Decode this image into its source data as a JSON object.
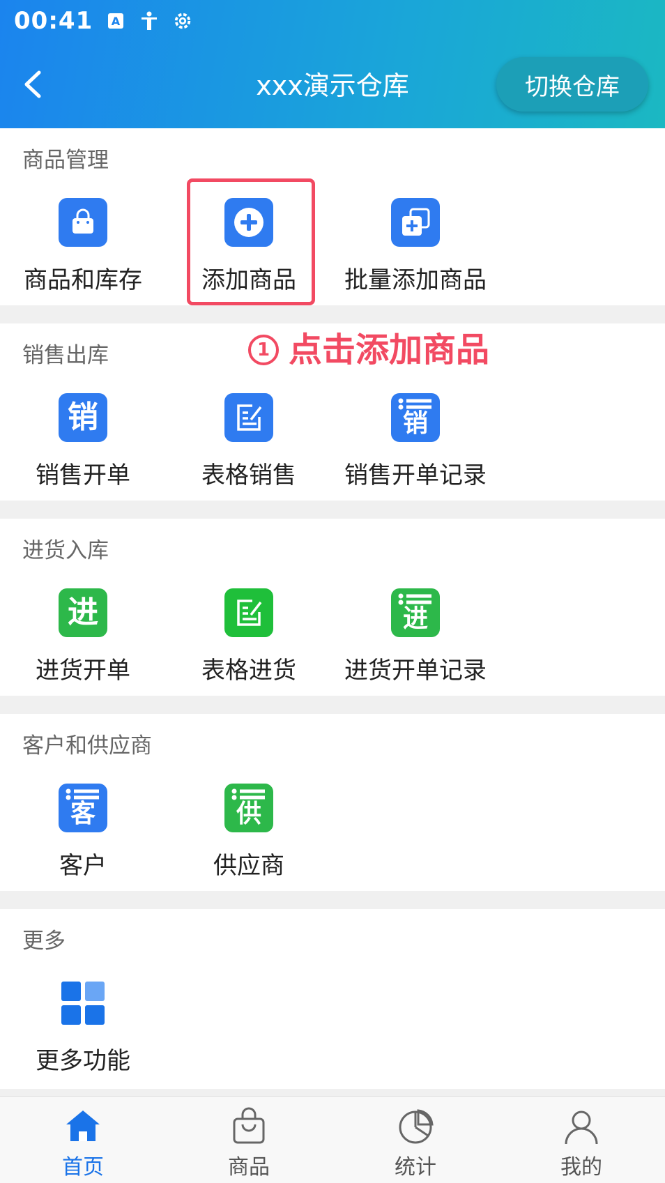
{
  "status_bar": {
    "time": "00:41"
  },
  "header": {
    "title": "xxx演示仓库",
    "switch_label": "切换仓库"
  },
  "sections": [
    {
      "title": "商品管理",
      "items": [
        {
          "label": "商品和库存",
          "icon": "shopping-bag-icon",
          "color": "#2f7bf0"
        },
        {
          "label": "添加商品",
          "icon": "plus-circle-icon",
          "color": "#2f7bf0"
        },
        {
          "label": "批量添加商品",
          "icon": "batch-add-icon",
          "color": "#2f7bf0"
        }
      ]
    },
    {
      "title": "销售出库",
      "items": [
        {
          "label": "销售开单",
          "icon": "sale-icon",
          "glyph": "销",
          "color": "#2f7bf0"
        },
        {
          "label": "表格销售",
          "icon": "edit-form-icon",
          "color": "#2f7bf0"
        },
        {
          "label": "销售开单记录",
          "icon": "sale-list-icon",
          "glyph": "销",
          "color": "#2f7bf0"
        }
      ]
    },
    {
      "title": "进货入库",
      "items": [
        {
          "label": "进货开单",
          "icon": "purchase-icon",
          "glyph": "进",
          "color": "#2db84a"
        },
        {
          "label": "表格进货",
          "icon": "edit-form-icon",
          "color": "#2db84a"
        },
        {
          "label": "进货开单记录",
          "icon": "purchase-list-icon",
          "glyph": "进",
          "color": "#2db84a"
        }
      ]
    },
    {
      "title": "客户和供应商",
      "items": [
        {
          "label": "客户",
          "icon": "customer-list-icon",
          "glyph": "客",
          "color": "#2f7bf0"
        },
        {
          "label": "供应商",
          "icon": "supplier-list-icon",
          "glyph": "供",
          "color": "#2db84a"
        }
      ]
    },
    {
      "title": "更多",
      "items": [
        {
          "label": "更多功能",
          "icon": "grid-icon",
          "color": "#1a73e8"
        }
      ]
    }
  ],
  "annotation": {
    "number": "①",
    "text": "点击添加商品",
    "color": "#f24a62"
  },
  "tabbar": [
    {
      "label": "首页",
      "icon": "home-icon",
      "active": true
    },
    {
      "label": "商品",
      "icon": "bag-icon",
      "active": false
    },
    {
      "label": "统计",
      "icon": "pie-chart-icon",
      "active": false
    },
    {
      "label": "我的",
      "icon": "user-icon",
      "active": false
    }
  ]
}
